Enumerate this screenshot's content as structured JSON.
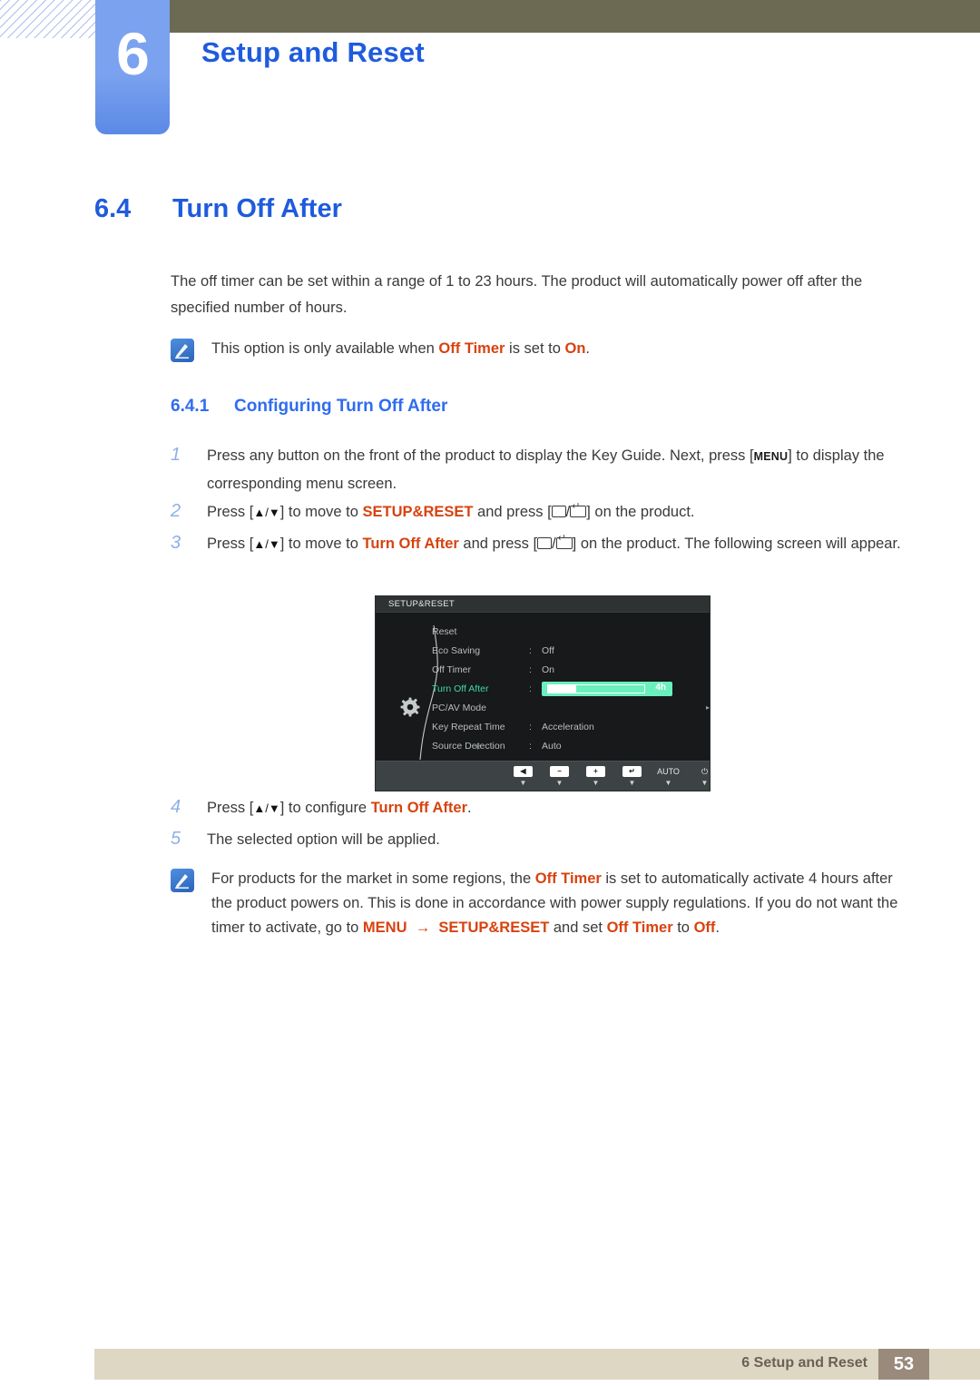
{
  "chapter": {
    "number": "6",
    "title": "Setup and Reset"
  },
  "section": {
    "number": "6.4",
    "title": "Turn Off After"
  },
  "intro": {
    "text": "The off timer can be set within a range of 1 to 23 hours. The product will automatically power off after the specified number of hours."
  },
  "note_1": {
    "icon": "note-pen-icon",
    "prefix": "This option is only available when ",
    "emph_1": "Off Timer",
    "mid": " is set to ",
    "emph_2": "On",
    "suffix": "."
  },
  "subsection": {
    "number": "6.4.1",
    "title": "Configuring Turn Off After"
  },
  "steps": [
    {
      "num": "1",
      "p1": "Press any button on the front of the product to display the Key Guide. Next, press [",
      "key": "MENU",
      "p2": "] to display the corresponding menu screen."
    },
    {
      "num": "2",
      "p1": "Press [",
      "arrows": "▲/▼",
      "p2": "] to move to ",
      "emph": "SETUP&RESET",
      "p3": " and press [",
      "p4": "] on the product."
    },
    {
      "num": "3",
      "p1": "Press [",
      "arrows": "▲/▼",
      "p2": "] to move to ",
      "emph": "Turn Off After",
      "p3": " and press [",
      "p4": "] on the product. The following screen will appear."
    },
    {
      "num": "4",
      "p1": "Press [",
      "arrows": "▲/▼",
      "p2": "] to configure ",
      "emph": "Turn Off After",
      "p3": "."
    },
    {
      "num": "5",
      "p1": "The selected option will be applied."
    }
  ],
  "osd": {
    "title": "SETUP&RESET",
    "gear_icon": "gear-icon",
    "rows": [
      {
        "label": "Reset",
        "colon": "",
        "value": "",
        "selected": false,
        "type": "plain"
      },
      {
        "label": "Eco Saving",
        "colon": ":",
        "value": "Off",
        "selected": false,
        "type": "value"
      },
      {
        "label": "Off Timer",
        "colon": ":",
        "value": "On",
        "selected": false,
        "type": "value"
      },
      {
        "label": "Turn Off After",
        "colon": ":",
        "value": "4h",
        "selected": true,
        "type": "slider"
      },
      {
        "label": "PC/AV Mode",
        "colon": "",
        "value": "",
        "selected": false,
        "type": "submenu"
      },
      {
        "label": "Key Repeat Time",
        "colon": ":",
        "value": "Acceleration",
        "selected": false,
        "type": "value"
      },
      {
        "label": "Source Detection",
        "colon": ":",
        "value": "Auto",
        "selected": false,
        "type": "value"
      }
    ],
    "slider": {
      "value_label": "4h",
      "fill_percent": 30
    },
    "scroll_down_icon": "▼",
    "buttons": [
      {
        "glyph": "◀",
        "name": "osd-button-left",
        "is_text": false
      },
      {
        "glyph": "−",
        "name": "osd-button-minus",
        "is_text": false
      },
      {
        "glyph": "+",
        "name": "osd-button-plus",
        "is_text": false
      },
      {
        "glyph": "↵",
        "name": "osd-button-enter",
        "is_text": false
      },
      {
        "glyph": "AUTO",
        "name": "osd-button-auto",
        "is_text": true
      },
      {
        "glyph": "⏻",
        "name": "osd-button-power",
        "is_text": true
      }
    ],
    "button_tick": "▼"
  },
  "note_2": {
    "icon": "note-pen-icon",
    "p1": "For products for the market in some regions, the ",
    "emph_1": "Off Timer",
    "p2": " is set to automatically activate 4 hours after the product powers on. This is done in accordance with power supply regulations. If you do not want the timer to activate, go to ",
    "emph_2": "MENU",
    "arrow": "→",
    "emph_3": "SETUP&RESET",
    "p3": " and set ",
    "emph_4": "Off Timer",
    "p4": " to ",
    "emph_5": "Off",
    "p5": "."
  },
  "footer": {
    "text": "6 Setup and Reset",
    "page": "53"
  },
  "colors": {
    "heading_blue": "#1f5bdd",
    "subheading_blue": "#2f6cf0",
    "emphasis_orange": "#d8420f",
    "topbar_olive": "#6d6a53",
    "tab_blue": "#7ba2ef",
    "footer_beige": "#ddd7c4",
    "footer_page_taupe": "#9a8a7c",
    "osd_green": "#6af0bd",
    "osd_bg": "#17191a"
  }
}
